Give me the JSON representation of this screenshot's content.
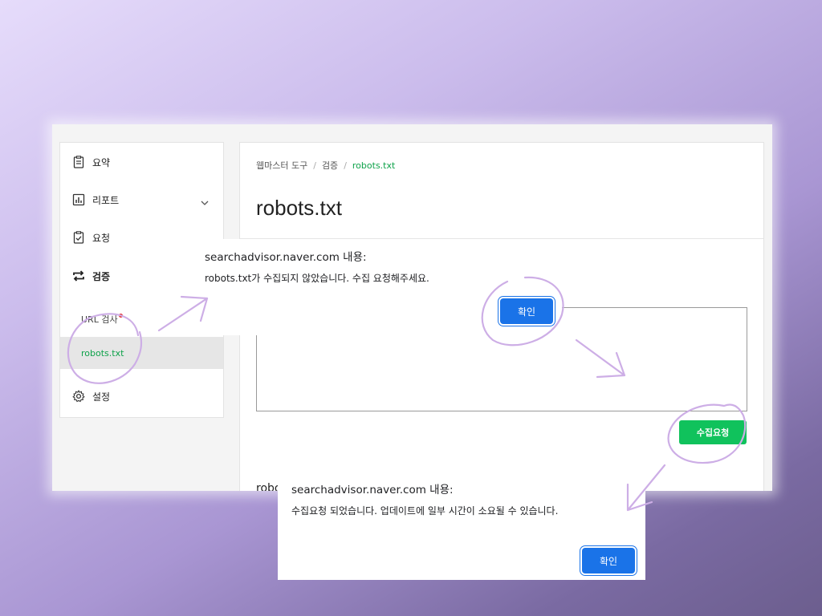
{
  "sidebar": {
    "items": [
      {
        "label": "요약",
        "icon": "clipboard-icon"
      },
      {
        "label": "리포트",
        "icon": "bar-chart-icon"
      },
      {
        "label": "요청",
        "icon": "clipboard-check-icon"
      },
      {
        "label": "검증",
        "icon": "repeat-arrows-icon"
      }
    ],
    "sub_items": [
      {
        "label": "URL 검사"
      },
      {
        "label": "robots.txt"
      }
    ],
    "settings": {
      "label": "설정",
      "icon": "gear-icon"
    }
  },
  "breadcrumb": {
    "items": [
      "웹마스터 도구",
      "검증"
    ],
    "separator": "/",
    "current": "robots.txt"
  },
  "main": {
    "title": "robots.txt",
    "collect_button": "수집요청",
    "cut_text": "robo"
  },
  "dialog1": {
    "title": "searchadvisor.naver.com 내용:",
    "message": "robots.txt가 수집되지 않았습니다. 수집 요청해주세요.",
    "ok_label": "확인"
  },
  "dialog2": {
    "title": "searchadvisor.naver.com 내용:",
    "message": "수집요청 되었습니다. 업데이트에 일부 시간이 소요될 수 있습니다.",
    "ok_label": "확인"
  },
  "colors": {
    "accent_green": "#10c25c",
    "active_text_green": "#0ea24a",
    "dialog_button_blue": "#1a73e8",
    "annotation_purple": "#c9a8e0"
  }
}
